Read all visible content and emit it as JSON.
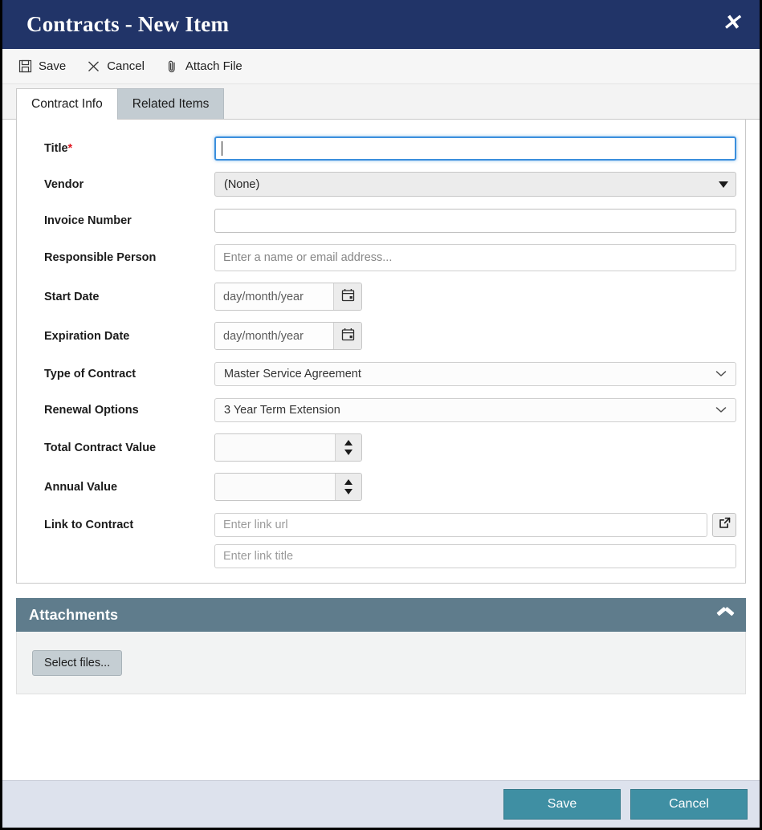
{
  "window": {
    "title": "Contracts - New Item",
    "close_label": "✕",
    "close_icon": "close-icon"
  },
  "commandbar": {
    "items": [
      {
        "label": "Save",
        "icon": "save-disk-icon"
      },
      {
        "label": "Cancel",
        "icon": "close-x-icon"
      },
      {
        "label": "Attach File",
        "icon": "paperclip-icon"
      }
    ]
  },
  "tabs": [
    {
      "label": "Contract Info",
      "active": true
    },
    {
      "label": "Related Items",
      "active": false
    }
  ],
  "form": {
    "title": {
      "label": "Title",
      "required_marker": "*",
      "value": "",
      "placeholder": ""
    },
    "vendor": {
      "label": "Vendor",
      "value": "(None)"
    },
    "invoice_number": {
      "label": "Invoice Number",
      "value": "",
      "placeholder": ""
    },
    "responsible_person": {
      "label": "Responsible Person",
      "value": "",
      "placeholder": "Enter a name or email address..."
    },
    "start_date": {
      "label": "Start Date",
      "value": "day/month/year",
      "icon": "calendar-icon"
    },
    "expiration_date": {
      "label": "Expiration Date",
      "value": "day/month/year",
      "icon": "calendar-icon"
    },
    "type_of_contract": {
      "label": "Type of Contract",
      "value": "Master Service Agreement"
    },
    "renewal_options": {
      "label": "Renewal Options",
      "value": "3 Year Term Extension"
    },
    "total_contract_value": {
      "label": "Total Contract Value",
      "value": ""
    },
    "annual_value": {
      "label": "Annual Value",
      "value": ""
    },
    "link_to_contract": {
      "label": "Link to Contract",
      "url_placeholder": "Enter link url",
      "url_value": "",
      "title_placeholder": "Enter link title",
      "title_value": "",
      "button_icon": "external-link-icon"
    }
  },
  "attachments": {
    "header": "Attachments",
    "collapse_icon": "chevron-up-icon",
    "select_files_label": "Select files..."
  },
  "footer": {
    "save_label": "Save",
    "cancel_label": "Cancel"
  },
  "colors": {
    "titlebar": "#213468",
    "attachments_header": "#5f7c8c",
    "footer_bg": "#dde2ed",
    "primary_button": "#3f8fa3",
    "required_marker": "#e01b24",
    "focus_border": "#3b8fdd"
  }
}
